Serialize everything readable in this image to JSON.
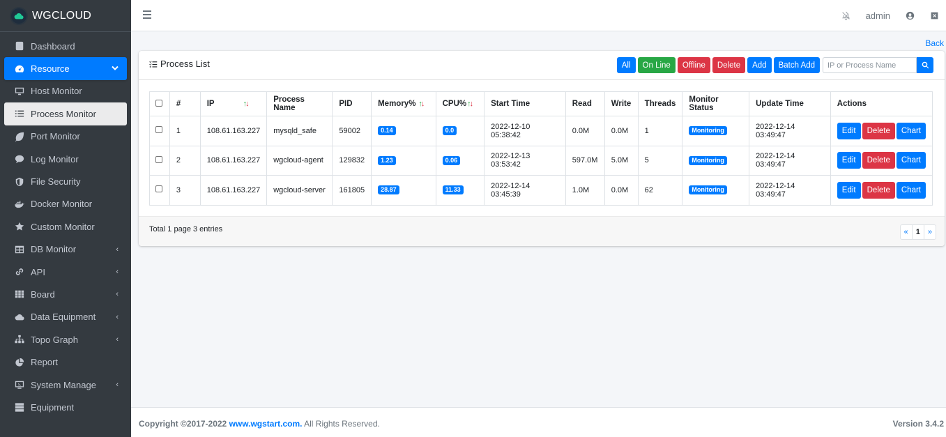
{
  "brand": {
    "name": "WGCLOUD"
  },
  "sidebar": {
    "items": [
      {
        "label": "Dashboard",
        "icon": "dashboard-icon"
      },
      {
        "label": "Resource",
        "icon": "tachometer-icon",
        "chevron": "⌄"
      },
      {
        "label": "Host Monitor",
        "icon": "desktop-icon"
      },
      {
        "label": "Process Monitor",
        "icon": "list-icon"
      },
      {
        "label": "Port Monitor",
        "icon": "leaf-icon"
      },
      {
        "label": "Log Monitor",
        "icon": "comment-icon"
      },
      {
        "label": "File Security",
        "icon": "shield-icon"
      },
      {
        "label": "Docker Monitor",
        "icon": "docker-icon"
      },
      {
        "label": "Custom Monitor",
        "icon": "star-icon"
      },
      {
        "label": "DB Monitor",
        "icon": "table-icon",
        "chevron": "‹"
      },
      {
        "label": "API",
        "icon": "link-icon",
        "chevron": "‹"
      },
      {
        "label": "Board",
        "icon": "grid-icon",
        "chevron": "‹"
      },
      {
        "label": "Data Equipment",
        "icon": "cloud-icon",
        "chevron": "‹"
      },
      {
        "label": "Topo Graph",
        "icon": "sitemap-icon",
        "chevron": "‹"
      },
      {
        "label": "Report",
        "icon": "pie-chart-icon"
      },
      {
        "label": "System Manage",
        "icon": "tv-icon",
        "chevron": "‹"
      },
      {
        "label": "Equipment",
        "icon": "server-icon"
      }
    ]
  },
  "topbar": {
    "user": "admin"
  },
  "back_label": "Back",
  "card": {
    "title": "Process List",
    "buttons": {
      "all": "All",
      "online": "On Line",
      "offline": "Offline",
      "delete": "Delete",
      "add": "Add",
      "batch_add": "Batch Add"
    },
    "search_placeholder": "IP or Process Name"
  },
  "table": {
    "headers": {
      "num": "#",
      "ip": "IP",
      "process": "Process Name",
      "pid": "PID",
      "memory": "Memory%",
      "cpu": "CPU%",
      "start": "Start Time",
      "read": "Read",
      "write": "Write",
      "threads": "Threads",
      "status": "Monitor Status",
      "update": "Update Time",
      "actions": "Actions"
    },
    "rows": [
      {
        "num": "1",
        "ip": "108.61.163.227",
        "process": "mysqld_safe",
        "pid": "59002",
        "memory": "0.14",
        "cpu": "0.0",
        "start": "2022-12-10 05:38:42",
        "read": "0.0M",
        "write": "0.0M",
        "threads": "1",
        "status": "Monitoring",
        "update": "2022-12-14 03:49:47"
      },
      {
        "num": "2",
        "ip": "108.61.163.227",
        "process": "wgcloud-agent",
        "pid": "129832",
        "memory": "1.23",
        "cpu": "0.06",
        "start": "2022-12-13 03:53:42",
        "read": "597.0M",
        "write": "5.0M",
        "threads": "5",
        "status": "Monitoring",
        "update": "2022-12-14 03:49:47"
      },
      {
        "num": "3",
        "ip": "108.61.163.227",
        "process": "wgcloud-server",
        "pid": "161805",
        "memory": "28.87",
        "cpu": "11.33",
        "start": "2022-12-14 03:45:39",
        "read": "1.0M",
        "write": "0.0M",
        "threads": "62",
        "status": "Monitoring",
        "update": "2022-12-14 03:49:47"
      }
    ],
    "actions": {
      "edit": "Edit",
      "delete": "Delete",
      "chart": "Chart"
    }
  },
  "footer": {
    "total": "Total 1 page  3 entries",
    "pager": {
      "prev": "«",
      "page": "1",
      "next": "»"
    },
    "copyright_prefix": "Copyright ©2017-2022 ",
    "copyright_link": "www.wgstart.com.",
    "copyright_suffix": " All Rights Reserved.",
    "version": "Version 3.4.2"
  },
  "colors": {
    "primary": "#007bff",
    "success": "#28a745",
    "danger": "#dc3545",
    "sidebar": "#343a40"
  }
}
